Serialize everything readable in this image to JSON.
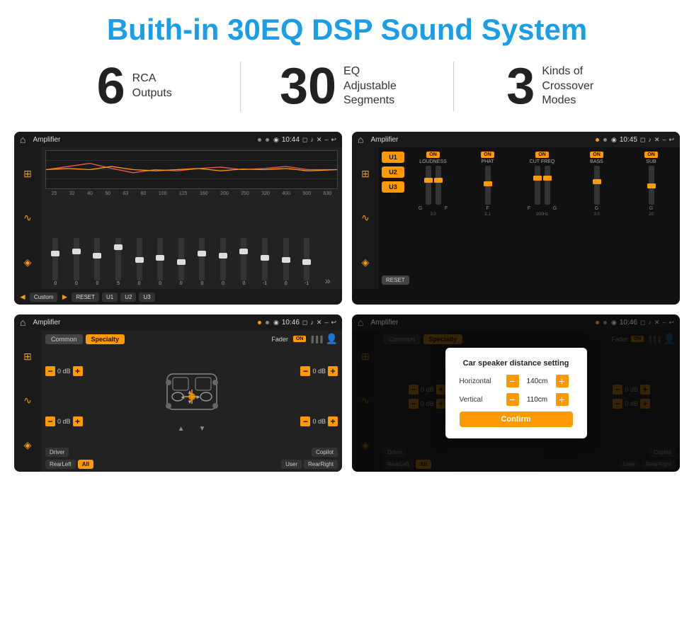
{
  "header": {
    "title": "Buith-in 30EQ DSP Sound System"
  },
  "stats": [
    {
      "number": "6",
      "label_line1": "RCA",
      "label_line2": "Outputs"
    },
    {
      "number": "30",
      "label_line1": "EQ Adjustable",
      "label_line2": "Segments"
    },
    {
      "number": "3",
      "label_line1": "Kinds of",
      "label_line2": "Crossover Modes"
    }
  ],
  "screens": {
    "eq": {
      "title": "Amplifier",
      "time": "10:44",
      "labels": [
        "25",
        "32",
        "40",
        "50",
        "63",
        "80",
        "100",
        "125",
        "160",
        "200",
        "250",
        "320",
        "400",
        "500",
        "630"
      ],
      "values": [
        "0",
        "0",
        "0",
        "5",
        "0",
        "0",
        "0",
        "0",
        "0",
        "0",
        "-1",
        "0",
        "-1"
      ],
      "footer": {
        "prev": "◄",
        "name": "Custom",
        "play": "►",
        "reset": "RESET",
        "u1": "U1",
        "u2": "U2",
        "u3": "U3"
      }
    },
    "amp2": {
      "title": "Amplifier",
      "time": "10:45",
      "presets": [
        "U1",
        "U2",
        "U3"
      ],
      "channels": [
        {
          "on": "ON",
          "name": "LOUDNESS"
        },
        {
          "on": "ON",
          "name": "PHAT"
        },
        {
          "on": "ON",
          "name": "CUT FREQ"
        },
        {
          "on": "ON",
          "name": "BASS"
        },
        {
          "on": "ON",
          "name": "SUB"
        }
      ],
      "reset": "RESET"
    },
    "fader": {
      "title": "Amplifier",
      "time": "10:46",
      "tabs": [
        "Common",
        "Specialty"
      ],
      "fader_label": "Fader",
      "on_badge": "ON",
      "db_values": [
        "0 dB",
        "0 dB",
        "0 dB",
        "0 dB"
      ],
      "footer_buttons": [
        "Driver",
        "RearLeft",
        "All",
        "User",
        "Copilot",
        "RearRight"
      ]
    },
    "dialog": {
      "title": "Amplifier",
      "time": "10:46",
      "dialog_title": "Car speaker distance setting",
      "horizontal_label": "Horizontal",
      "horizontal_value": "140cm",
      "vertical_label": "Vertical",
      "vertical_value": "110cm",
      "confirm_label": "Confirm",
      "db_values": [
        "0 dB",
        "0 dB"
      ],
      "footer_buttons": [
        "Driver",
        "RearLeft",
        "All",
        "User",
        "Copilot",
        "RearRight"
      ]
    }
  },
  "icons": {
    "home": "⌂",
    "back": "↩",
    "location": "◉",
    "camera": "◻",
    "volume": "♪",
    "close_x": "✕",
    "minimize": "–",
    "eq_icon": "⊞",
    "wave_icon": "∿",
    "speaker_icon": "◈",
    "settings_icon": "⚙",
    "person_icon": "👤",
    "chevron_up": "▲",
    "chevron_down": "▼",
    "chevron_left": "◄",
    "chevron_right": "►",
    "next_arrows": "»"
  }
}
